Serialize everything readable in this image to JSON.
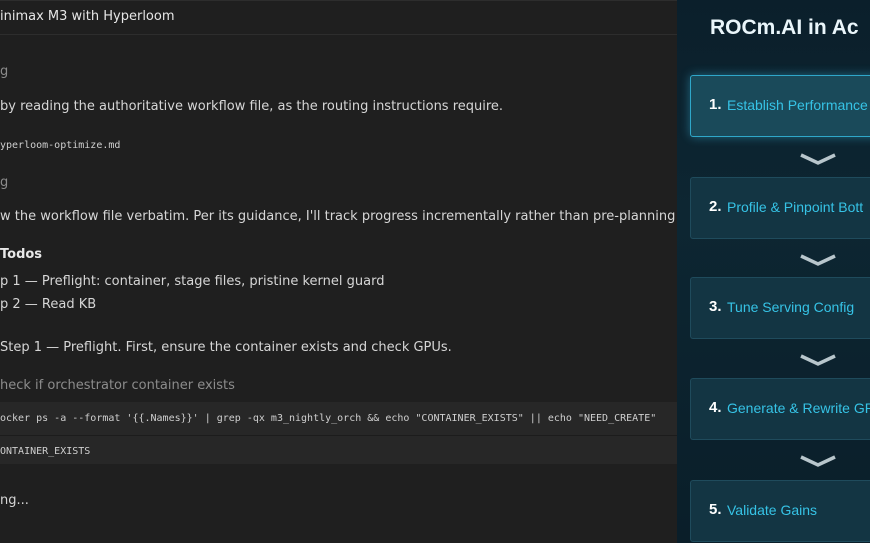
{
  "conversation": {
    "title": "inimax M3 with Hyperloom",
    "lines": [
      {
        "text": "g",
        "kind": "muted"
      },
      {
        "text": "by reading the authoritative workflow file, as the routing instructions require.",
        "kind": "body"
      },
      {
        "text": "yperloom-optimize.md",
        "kind": "mono"
      },
      {
        "text": "g",
        "kind": "muted"
      },
      {
        "text": "w the workflow file verbatim. Per its guidance, I'll track progress incrementally rather than pre-planning the whole ladder",
        "kind": "body"
      },
      {
        "text": "Todos",
        "kind": "bold"
      },
      {
        "text": "p 1 — Preflight: container, stage files, pristine kernel guard",
        "kind": "body"
      },
      {
        "text": "p 2 — Read KB",
        "kind": "body"
      },
      {
        "text": "Step 1 — Preflight. First, ensure the container exists and check GPUs.",
        "kind": "body"
      },
      {
        "text": "heck if orchestrator container exists",
        "kind": "muted"
      }
    ],
    "command": "ocker ps -a --format '{{.Names}}' | grep -qx m3_nightly_orch && echo \"CONTAINER_EXISTS\" || echo \"NEED_CREATE\"",
    "output": "ONTAINER_EXISTS",
    "status": "ng..."
  },
  "panel": {
    "title": "ROCm.AI in Ac",
    "steps": [
      {
        "num": "1.",
        "label": "Establish Performance",
        "active": true
      },
      {
        "num": "2.",
        "label": "Profile & Pinpoint Bott",
        "active": false
      },
      {
        "num": "3.",
        "label": "Tune Serving Config",
        "active": false
      },
      {
        "num": "4.",
        "label": "Generate & Rewrite GP",
        "active": false
      },
      {
        "num": "5.",
        "label": "Validate Gains",
        "active": false
      }
    ],
    "colors": {
      "accent": "#36c3e6",
      "background": "#0d2632"
    }
  }
}
